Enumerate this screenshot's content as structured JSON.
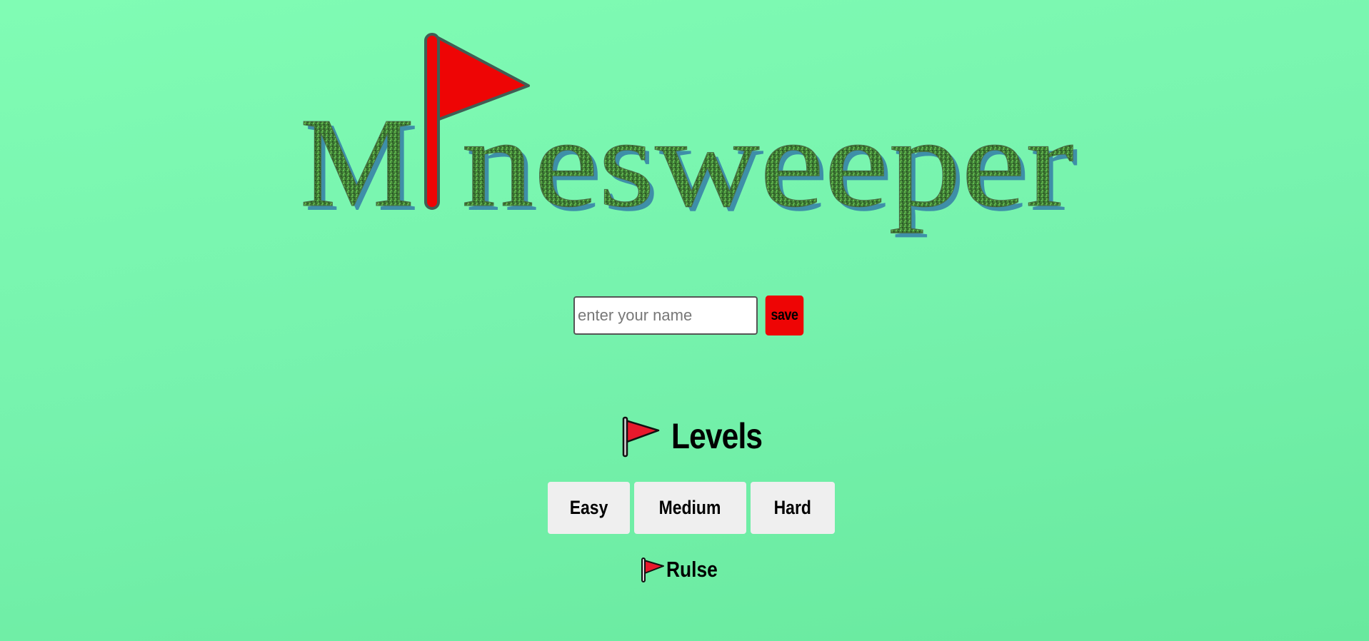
{
  "logo": {
    "title": "Minesweeper",
    "text_after_flag": "nesweeper",
    "first_letter": "M"
  },
  "name_form": {
    "placeholder": "enter your name",
    "value": "",
    "save_label": "save"
  },
  "levels": {
    "title": "Levels",
    "icon": "red-flag-icon",
    "buttons": [
      {
        "label": "Easy"
      },
      {
        "label": "Medium"
      },
      {
        "label": "Hard"
      }
    ]
  },
  "rules": {
    "label": "Rulse",
    "icon": "red-flag-icon"
  },
  "colors": {
    "background": "#7ef8b2",
    "flag_red": "#ee0505",
    "save_button": "#ee0505",
    "logo_text": "#3e7f3c",
    "logo_shadow": "#3e8fa8",
    "level_button_bg": "#efefef"
  }
}
